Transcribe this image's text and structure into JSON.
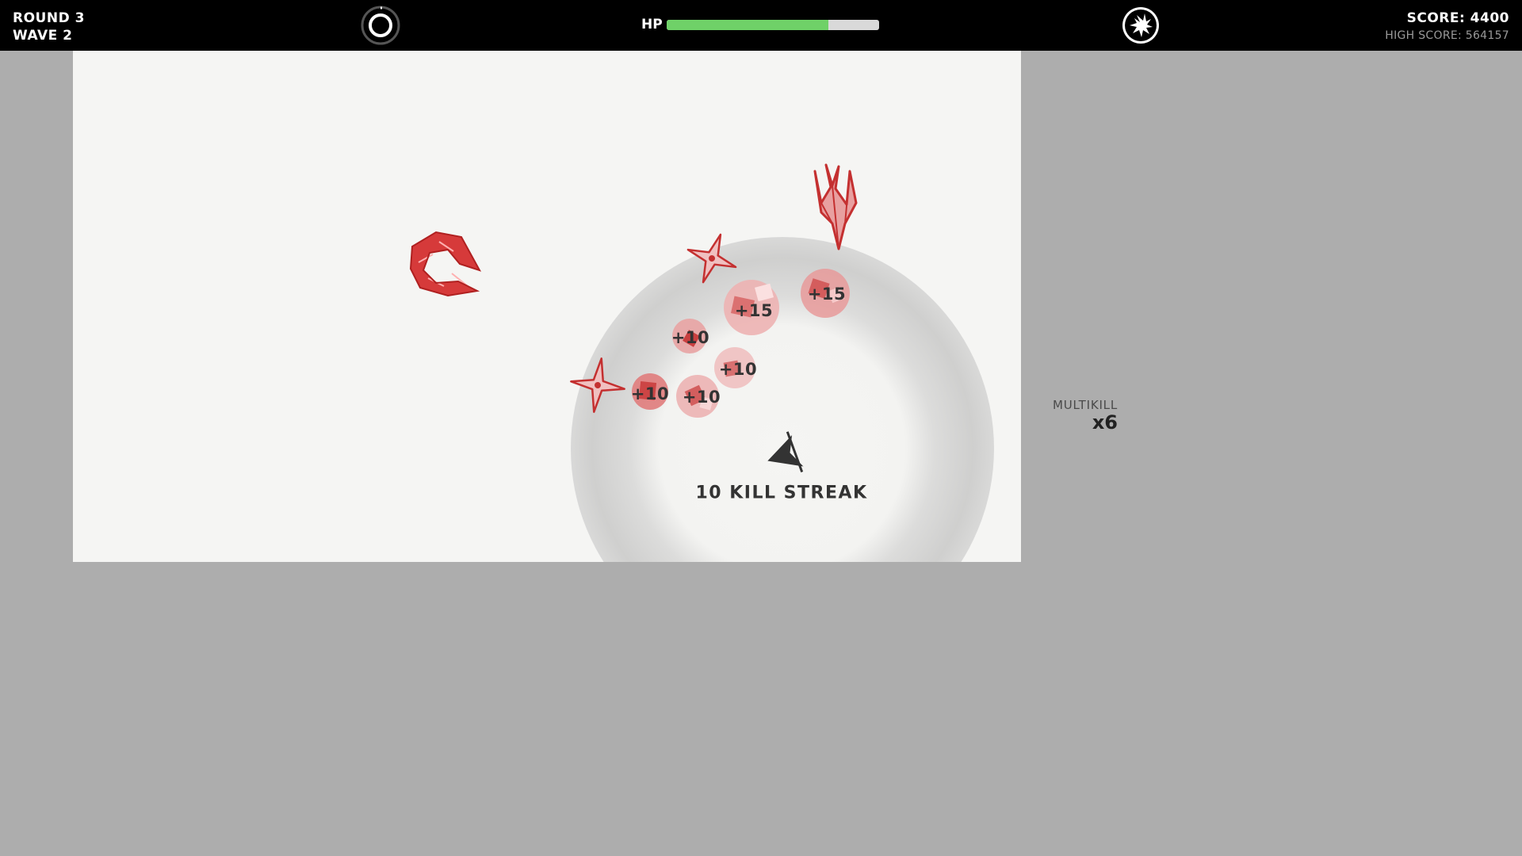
{
  "hud": {
    "round": "ROUND 3",
    "wave": "WAVE 2",
    "hp_label": "HP",
    "hp_fraction": 0.76,
    "score": "SCORE: 4400",
    "high_score": "HIGH SCORE: 564157",
    "ability_left_icon": "ring-ability-icon",
    "ability_right_icon": "burst-ability-icon"
  },
  "arena": {
    "popups": [
      "+15",
      "+15",
      "+10",
      "+10",
      "+10",
      "+10"
    ],
    "kill_streak": "10 KILL STREAK",
    "enemy_color": "#d63a3a",
    "player_color": "#333333"
  },
  "multikill": {
    "label": "MULTIKILL",
    "count": "x6"
  }
}
